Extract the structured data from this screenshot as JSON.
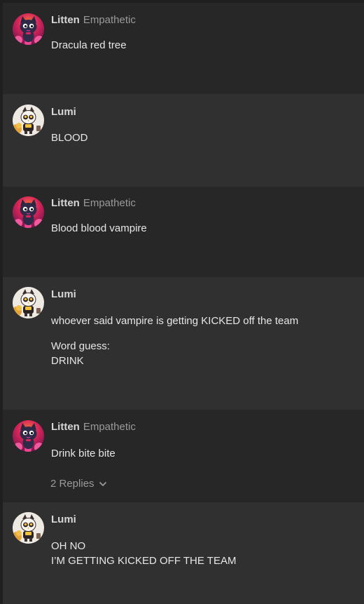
{
  "posts": [
    {
      "author": "Litten",
      "badge": "Empathetic",
      "avatar_icon": "litten-cat-avatar-icon",
      "lines": [
        "Dracula red tree"
      ]
    },
    {
      "author": "Lumi",
      "badge": "",
      "avatar_icon": "lumi-avatar-icon",
      "lines": [
        "BLOOD"
      ]
    },
    {
      "author": "Litten",
      "badge": "Empathetic",
      "avatar_icon": "litten-cat-avatar-icon",
      "lines": [
        "Blood blood vampire"
      ]
    },
    {
      "author": "Lumi",
      "badge": "",
      "avatar_icon": "lumi-avatar-icon",
      "lines": [
        "whoever said vampire is getting KICKED off the team",
        "Word guess:\nDRINK"
      ]
    },
    {
      "author": "Litten",
      "badge": "Empathetic",
      "avatar_icon": "litten-cat-avatar-icon",
      "lines": [
        "Drink bite bite"
      ],
      "replies": "2 Replies"
    },
    {
      "author": "Lumi",
      "badge": "",
      "avatar_icon": "lumi-avatar-icon",
      "lines": [
        "OH NO\nI’M GETTING KICKED OFF THE TEAM"
      ]
    }
  ],
  "colors": {
    "background": "#1f1f1f",
    "post_dark": "#272727",
    "post_light": "#303030",
    "author": "#d6d6d6",
    "muted": "#9a9a9a",
    "text": "#e6e6e6"
  }
}
